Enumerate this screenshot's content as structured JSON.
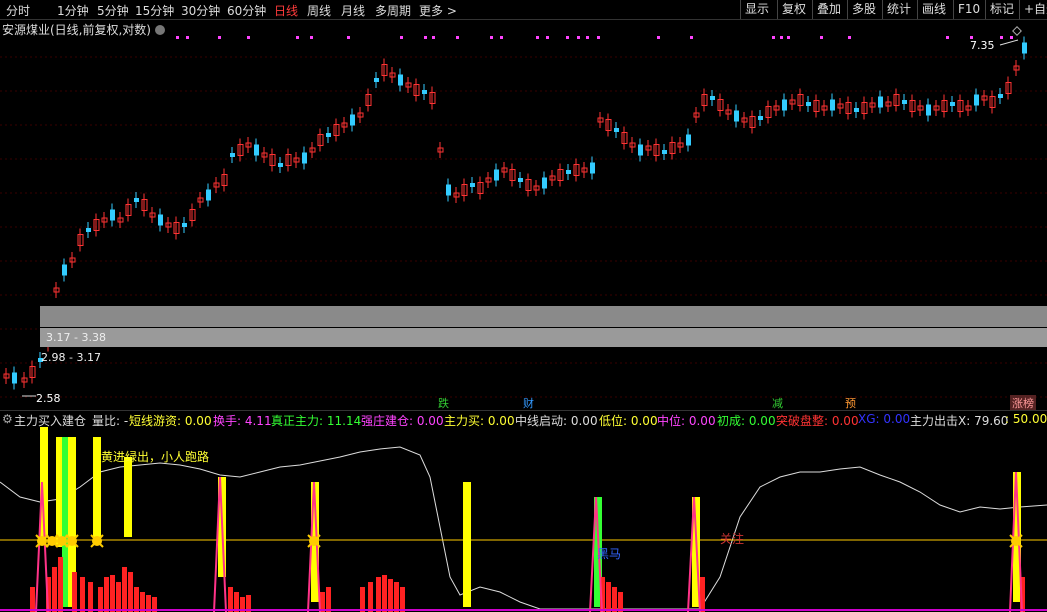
{
  "toolbar": {
    "periods": [
      "分时",
      "1分钟",
      "5分钟",
      "15分钟",
      "30分钟",
      "60分钟",
      "日线",
      "周线",
      "月线",
      "多周期",
      "更多 >"
    ],
    "active_period": "日线",
    "right_buttons": [
      "显示",
      "复权",
      "叠加",
      "多股",
      "统计",
      "画线",
      "F10",
      "标记",
      "+自选"
    ]
  },
  "chart": {
    "title": "安源煤业(日线,前复权,对数)",
    "high_label": "7.35",
    "low_label": "2.58",
    "band_upper_label": "3.17 - 3.38",
    "band_lower_label": "2.98 - 3.17"
  },
  "event_marks": [
    {
      "label": "跌",
      "color": "#33cc33"
    },
    {
      "label": "财",
      "color": "#3399ff"
    },
    {
      "label": "减",
      "color": "#33cc33"
    },
    {
      "label": "预",
      "color": "#ff9933"
    },
    {
      "label": "涨榜",
      "color": "#ff9999"
    }
  ],
  "indicator_row": {
    "name": "主力买入建仓",
    "items": [
      {
        "text": "量比: -",
        "color": "#dddddd"
      },
      {
        "text": "短线游资: 0.00",
        "color": "#ffff33"
      },
      {
        "text": "换手: 4.11",
        "color": "#ff44ff"
      },
      {
        "text": "真正主力: 11.14",
        "color": "#33ff33"
      },
      {
        "text": "强庄建仓: 0.00",
        "color": "#ff44ff"
      },
      {
        "text": "主力买: 0.00",
        "color": "#ffff33"
      },
      {
        "text": "中线启动: 0.00",
        "color": "#dddddd"
      },
      {
        "text": "低位: 0.00",
        "color": "#ffff33"
      },
      {
        "text": "中位: 0.00",
        "color": "#ff44ff"
      },
      {
        "text": "初成: 0.00",
        "color": "#33ff33"
      },
      {
        "text": "突破盘整: 0.00",
        "color": "#ff3333"
      },
      {
        "text": "XG: 0.00",
        "color": "#3333ff"
      },
      {
        "text": "主力出击X: 79.60",
        "color": "#dddddd"
      },
      {
        "text": ": 50.00",
        "color": "#ffff33"
      }
    ]
  },
  "lower": {
    "annotation": "黄进绿出，小人跑路",
    "label_heima": "黑马",
    "label_guanzhu": "关注"
  }
}
